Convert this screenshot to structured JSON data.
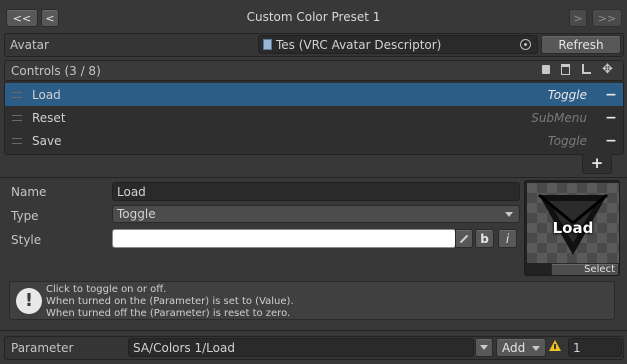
{
  "header": {
    "first_label": "<<",
    "prev_label": "<",
    "title": "Custom Color Preset 1",
    "next_label": ">",
    "last_label": ">>"
  },
  "avatar": {
    "label": "Avatar",
    "value": "Tes (VRC Avatar Descriptor)",
    "refresh_label": "Refresh"
  },
  "controls": {
    "title": "Controls (3 / 8)",
    "items": [
      {
        "name": "Load",
        "type": "Toggle",
        "selected": true
      },
      {
        "name": "Reset",
        "type": "SubMenu",
        "selected": false
      },
      {
        "name": "Save",
        "type": "Toggle",
        "selected": false
      }
    ],
    "remove_label": "−",
    "add_label": "+"
  },
  "detail": {
    "name_label": "Name",
    "name_value": "Load",
    "type_label": "Type",
    "type_value": "Toggle",
    "style_label": "Style",
    "style_value": "",
    "bold_label": "b",
    "italic_label": "i",
    "icon_text": "Load",
    "select_label": "Select"
  },
  "help": {
    "line1": "Click to toggle on or off.",
    "line2": "When turned on the (Parameter) is set to (Value).",
    "line3": "When turned off the (Parameter) is reset to zero."
  },
  "parameter": {
    "label": "Parameter",
    "value": "SA/Colors 1/Load",
    "mode_label": "Add",
    "number_value": "1"
  },
  "colors": {
    "selected_row": "#2c5d87",
    "background": "#383838",
    "warning": "#f0c020"
  }
}
